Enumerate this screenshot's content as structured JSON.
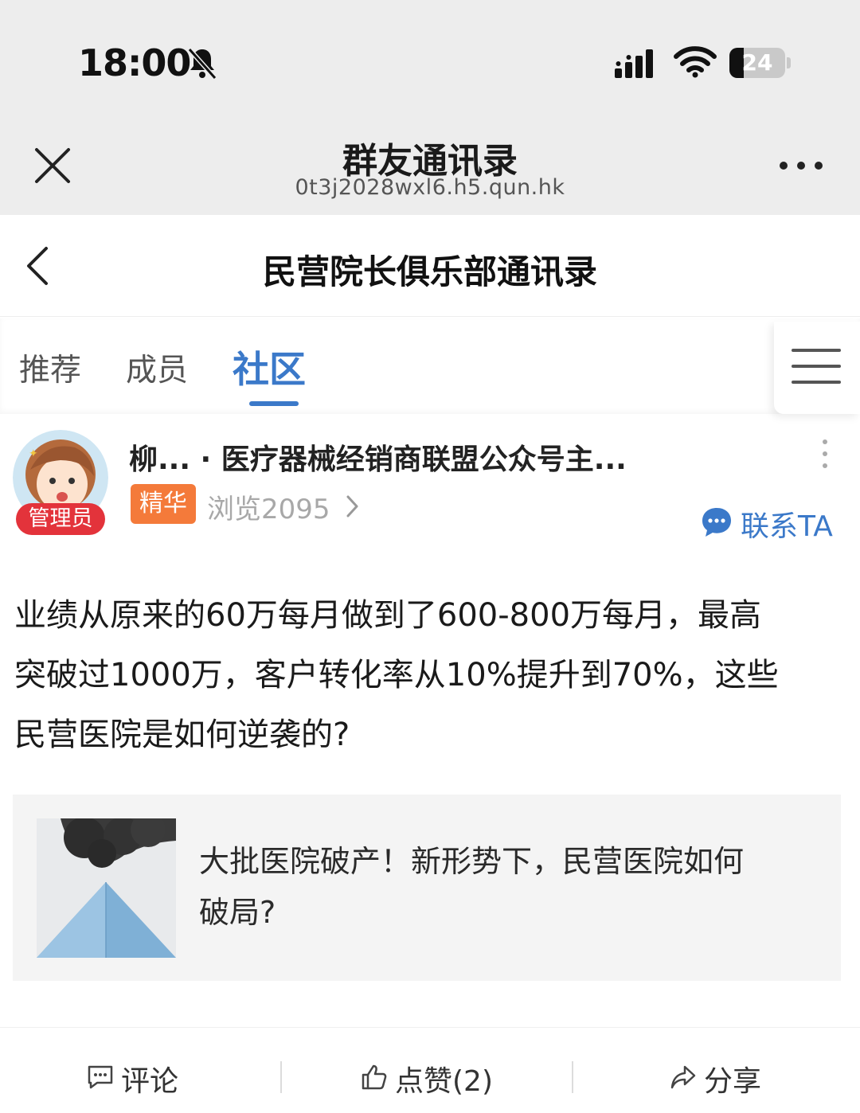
{
  "status_bar": {
    "time": "18:00",
    "battery": "24"
  },
  "webview": {
    "title": "群友通讯录",
    "url": "0t3j2028wxl6.h5.qun.hk"
  },
  "navbar": {
    "title": "民营院长俱乐部通讯录"
  },
  "tabs": [
    {
      "label": "推荐"
    },
    {
      "label": "成员"
    },
    {
      "label": "社区",
      "active": true
    }
  ],
  "post": {
    "admin_badge": "管理员",
    "author_line": "柳... · 医疗器械经销商联盟公众号主...",
    "featured_badge": "精华",
    "views": "浏览2095",
    "contact_label": "联系TA",
    "body_lines": [
      "业绩从原来的60万每月做到了600-800万每月，最高",
      "突破过1000万，客户转化率从10%提升到70%，这些",
      "民营医院是如何逆袭的?"
    ],
    "link_card": {
      "title_lines": [
        "大批医院破产！新形势下，民营医院如何",
        "破局?"
      ]
    }
  },
  "actions": {
    "comment": "评论",
    "like": "点赞(2)",
    "share": "分享"
  },
  "colors": {
    "accent": "#3b79c9",
    "admin_badge": "#e3333b",
    "featured_badge": "#f47a3a"
  },
  "icons": [
    "bell-muted-icon",
    "signal-icon",
    "wifi-icon",
    "close-icon",
    "more-icon",
    "back-icon",
    "menu-icon",
    "kebab-icon",
    "chevron-right-icon",
    "chat-bubble-icon",
    "comment-icon",
    "thumbs-up-icon",
    "share-icon"
  ]
}
